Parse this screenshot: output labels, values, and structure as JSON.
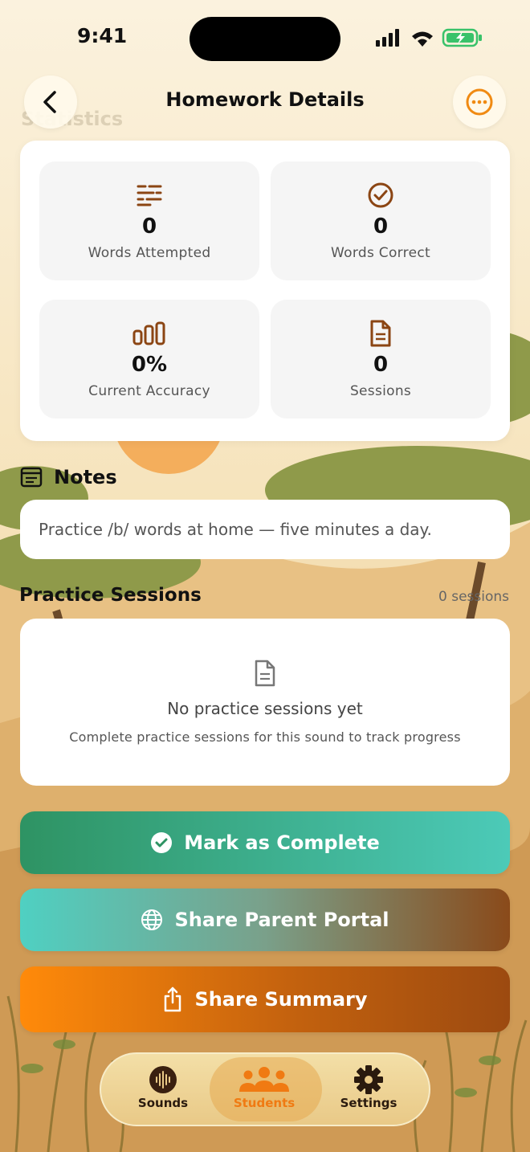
{
  "status_bar": {
    "time": "9:41"
  },
  "nav": {
    "title": "Homework Details",
    "back_icon": "chevron-left-icon",
    "more_icon": "ellipsis-circle-icon"
  },
  "background_header": {
    "section_label": "Statistics"
  },
  "stats": [
    {
      "icon": "list-lines-icon",
      "value": "0",
      "label": "Words Attempted"
    },
    {
      "icon": "check-circle-icon",
      "value": "0",
      "label": "Words Correct"
    },
    {
      "icon": "bar-chart-icon",
      "value": "0%",
      "label": "Current Accuracy"
    },
    {
      "icon": "document-icon",
      "value": "0",
      "label": "Sessions"
    }
  ],
  "notes": {
    "title": "Notes",
    "text": "Practice /b/ words at home — five minutes a day."
  },
  "practice_sessions": {
    "title": "Practice Sessions",
    "count": "0 sessions",
    "empty_title": "No practice sessions yet",
    "empty_subtitle": "Complete practice sessions for this sound to track progress"
  },
  "actions": {
    "complete": "Mark as Complete",
    "portal": "Share Parent Portal",
    "summary": "Share Summary"
  },
  "tabbar": {
    "items": [
      {
        "label": "Sounds",
        "icon": "waveform-icon"
      },
      {
        "label": "Students",
        "icon": "people-icon",
        "active": true
      },
      {
        "label": "Settings",
        "icon": "gear-icon"
      }
    ]
  },
  "colors": {
    "accent_brown": "#8b4513",
    "accent_orange": "#f07a12",
    "green": "#2e9363",
    "teal": "#4ccab8"
  }
}
